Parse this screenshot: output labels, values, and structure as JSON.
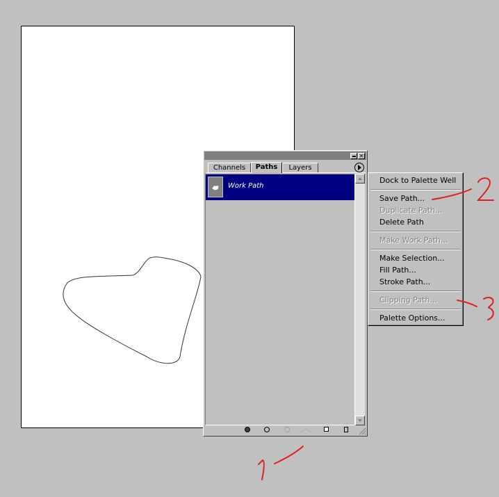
{
  "palette": {
    "tabs": [
      {
        "label": "Channels"
      },
      {
        "label": "Paths"
      },
      {
        "label": "Layers"
      }
    ],
    "active_tab": "Paths",
    "paths": [
      {
        "name": "Work Path",
        "selected": true
      }
    ],
    "bottom_tools": [
      "fill-path-icon",
      "stroke-path-icon",
      "load-path-as-selection-icon",
      "make-work-path-icon",
      "new-path-icon",
      "trash-icon"
    ]
  },
  "context_menu": {
    "groups": [
      [
        {
          "label": "Dock to Palette Well",
          "enabled": true
        }
      ],
      [
        {
          "label": "Save Path...",
          "enabled": true
        },
        {
          "label": "Duplicate Path...",
          "enabled": false
        },
        {
          "label": "Delete Path",
          "enabled": true
        }
      ],
      [
        {
          "label": "Make Work Path...",
          "enabled": false
        }
      ],
      [
        {
          "label": "Make Selection...",
          "enabled": true
        },
        {
          "label": "Fill Path...",
          "enabled": true
        },
        {
          "label": "Stroke Path...",
          "enabled": true
        }
      ],
      [
        {
          "label": "Clipping Path...",
          "enabled": false
        }
      ],
      [
        {
          "label": "Palette Options...",
          "enabled": true
        }
      ]
    ]
  },
  "annotations": [
    {
      "label": "1",
      "color": "#e02020"
    },
    {
      "label": "2",
      "color": "#e02020"
    },
    {
      "label": "3",
      "color": "#e02020"
    }
  ],
  "colors": {
    "background": "#c0c0c0",
    "selection": "#000080",
    "annotation": "#e02020"
  }
}
